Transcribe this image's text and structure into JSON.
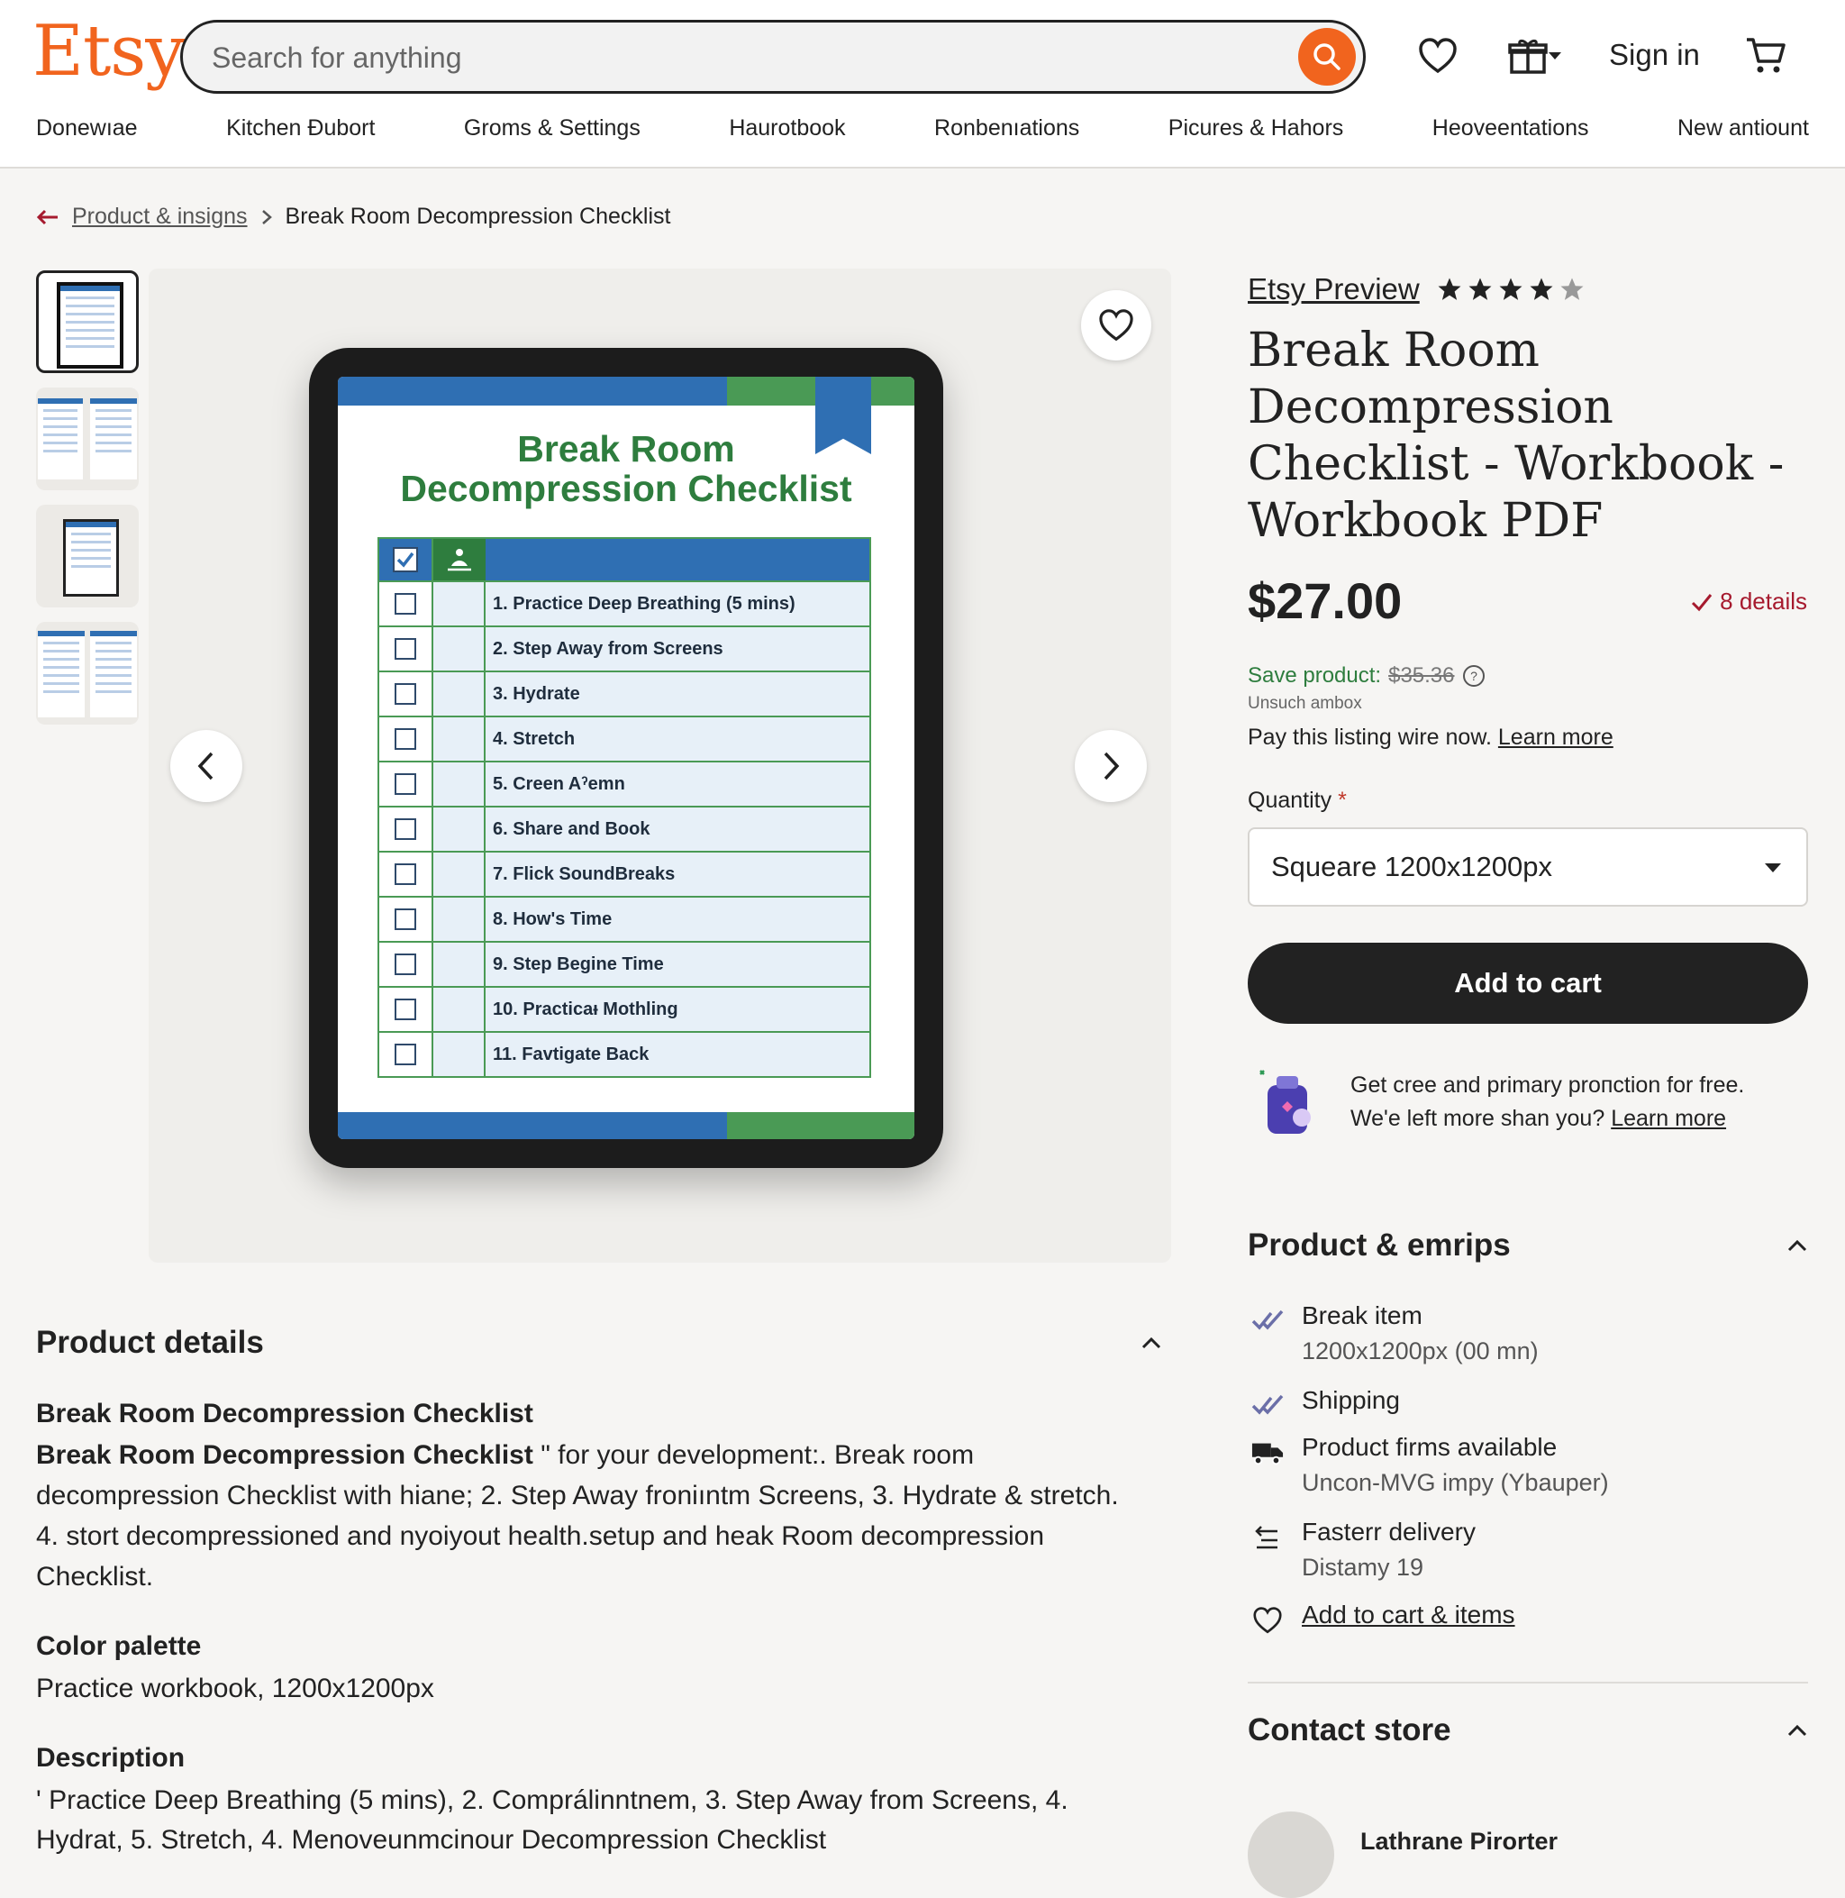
{
  "header": {
    "logo": "Etsy",
    "search_placeholder": "Search for anything",
    "sign_in": "Sign in",
    "nav": [
      "Donewıae",
      "Kitchen Ɖubort",
      "Groms & Settings",
      "Haurotbook",
      "Ronbenıations",
      "Picures & Hahors",
      "Heoveentations",
      "New antiount"
    ]
  },
  "breadcrumb": {
    "parent": "Product & insigns",
    "current": "Break Room Decompression Checklist"
  },
  "gallery": {
    "doc_title_line1": "Break Room",
    "doc_title_line2": "Decompression Checklist",
    "checklist": [
      "1. Practice Deep Breathing (5 mins)",
      "2. Step Away from Screens",
      "3. Hydrate",
      "4. Stretch",
      "5. Creen Aˀemn",
      "6. Share and Book",
      "7. Flick SoundBreaks",
      "8. How's Time",
      "9. Step Begine Time",
      "10. Practicaᵻ Mothling",
      "11. Favtigate Back"
    ]
  },
  "product": {
    "shop_name": "Etsy Preview",
    "rating": 4,
    "rating_max": 5,
    "title": "Break Room Decompression Checklist - Workbook - Workbook PDF",
    "price": "$27.00",
    "details_link": "8 details",
    "save_label": "Save product:",
    "original_price": "$35.36",
    "unsuch": "Unsuch ambox",
    "pay_text": "Pay this listing wire now.",
    "learn_more": "Learn more",
    "quantity_label": "Quantity",
    "required_mark": "*",
    "quantity_value": "Squeare 1200x1200px",
    "add_to_cart": "Add to cart",
    "promo_line1": "Get cree and primary proпction for free.",
    "promo_line2": "We'e left more shan you?",
    "promo_learn": "Learn more"
  },
  "features": {
    "title": "Product & emrips",
    "items": [
      {
        "label": "Break item",
        "sub": "1200x1200px (00 mn)",
        "icon": "double-check-icon"
      },
      {
        "label": "Shipping",
        "sub": "",
        "icon": "double-check-icon"
      },
      {
        "label": "Product firms available",
        "sub": "Uncon-MVG impy (Ybauper)",
        "icon": "truck-icon"
      },
      {
        "label": "Fasterr delivery",
        "sub": "Distamy 19",
        "icon": "delivery-icon"
      },
      {
        "label": "Add to cart & items",
        "sub": "",
        "icon": "heart-icon"
      }
    ]
  },
  "contact": {
    "title": "Contact store",
    "owner": "Lathrane Pirorter"
  },
  "details": {
    "title": "Product details",
    "subtitle": "Break Room Decompression Checklist",
    "body_bold": "Break Room Decompression Checklist",
    "body_text": " \" for your development:. Break room decompression Checklist with hiane; 2. Step Away froniıntm Screens, 3. Hydrate & stretch. 4. stort decompressioned and nyoiyout health.setup and heak Room decompression Checklist.",
    "color_heading": "Color palette",
    "color_text": "Practice workbook, 1200x1200px",
    "desc_heading": "Description",
    "desc_text": "' Practice Deep Breathing (5 mins), 2. Comprálinntnem, 3. Step Away from Screens, 4. Hydrat, 5. Stretch, 4. Menoveunmcinour Decompression Checklist"
  },
  "colors": {
    "brand": "#f1641e",
    "blue": "#2f6fb3",
    "green": "#2e7d3e",
    "sale_green": "#2e7d3e",
    "details_red": "#a61a2e"
  }
}
